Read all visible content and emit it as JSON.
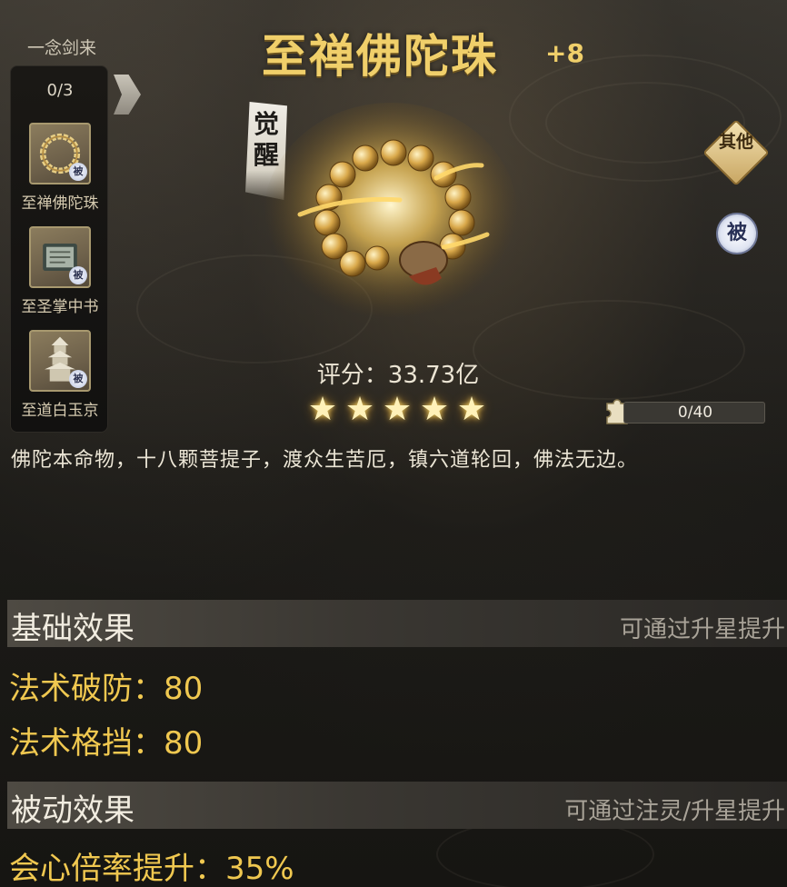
{
  "set": {
    "title": "一念剑来",
    "count": "0/3",
    "items": [
      {
        "name": "至禅佛陀珠",
        "badge": "被",
        "icon": "prayer-beads-icon"
      },
      {
        "name": "至圣掌中书",
        "badge": "被",
        "icon": "scroll-book-icon"
      },
      {
        "name": "至道白玉京",
        "badge": "被",
        "icon": "pagoda-icon"
      }
    ]
  },
  "item": {
    "name": "至禅佛陀珠",
    "level": "+8",
    "awaken": "觉醒",
    "badge_other": "其他",
    "badge_passive": "被",
    "score_label": "评分：",
    "score_value": "33.73亿",
    "stars": 5,
    "fragments": "0/40",
    "fragments_fraction": 0,
    "description": "佛陀本命物，十八颗菩提子，渡众生苦厄，镇六道轮回，佛法无边。"
  },
  "base_effect": {
    "title": "基础效果",
    "hint": "可通过升星提升",
    "stats": [
      "法术破防：80",
      "法术格挡：80"
    ]
  },
  "passive_effect": {
    "title": "被动效果",
    "hint": "可通过注灵/升星提升",
    "stats": [
      "会心倍率提升：35%"
    ]
  },
  "colors": {
    "title_gold": "#f0cf6a",
    "stat_gold": "#f0c850",
    "text_light": "#ece6d6",
    "hint_gray": "#a9a398"
  }
}
